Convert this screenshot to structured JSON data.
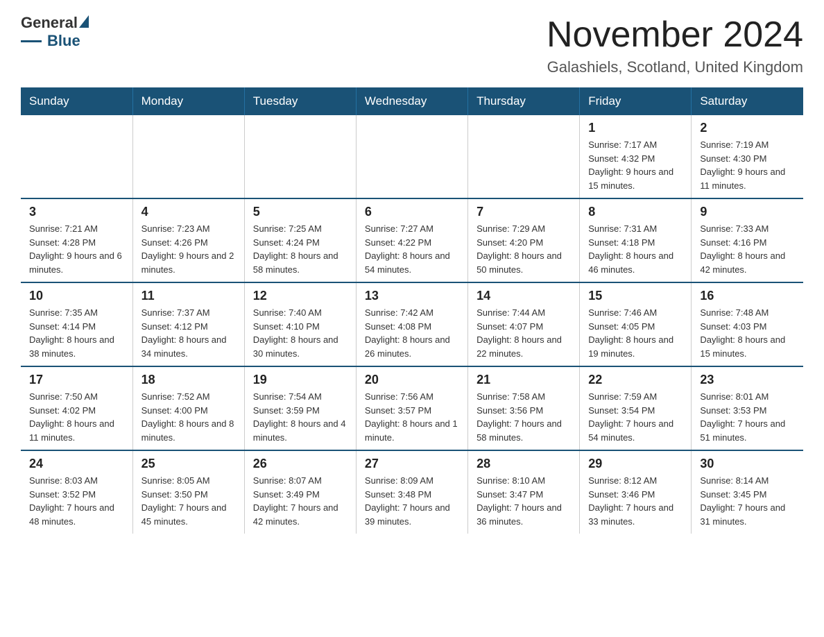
{
  "header": {
    "logo_text": "General",
    "logo_blue": "Blue",
    "month_title": "November 2024",
    "location": "Galashiels, Scotland, United Kingdom"
  },
  "days_of_week": [
    "Sunday",
    "Monday",
    "Tuesday",
    "Wednesday",
    "Thursday",
    "Friday",
    "Saturday"
  ],
  "weeks": [
    [
      {
        "day": "",
        "info": ""
      },
      {
        "day": "",
        "info": ""
      },
      {
        "day": "",
        "info": ""
      },
      {
        "day": "",
        "info": ""
      },
      {
        "day": "",
        "info": ""
      },
      {
        "day": "1",
        "info": "Sunrise: 7:17 AM\nSunset: 4:32 PM\nDaylight: 9 hours and 15 minutes."
      },
      {
        "day": "2",
        "info": "Sunrise: 7:19 AM\nSunset: 4:30 PM\nDaylight: 9 hours and 11 minutes."
      }
    ],
    [
      {
        "day": "3",
        "info": "Sunrise: 7:21 AM\nSunset: 4:28 PM\nDaylight: 9 hours and 6 minutes."
      },
      {
        "day": "4",
        "info": "Sunrise: 7:23 AM\nSunset: 4:26 PM\nDaylight: 9 hours and 2 minutes."
      },
      {
        "day": "5",
        "info": "Sunrise: 7:25 AM\nSunset: 4:24 PM\nDaylight: 8 hours and 58 minutes."
      },
      {
        "day": "6",
        "info": "Sunrise: 7:27 AM\nSunset: 4:22 PM\nDaylight: 8 hours and 54 minutes."
      },
      {
        "day": "7",
        "info": "Sunrise: 7:29 AM\nSunset: 4:20 PM\nDaylight: 8 hours and 50 minutes."
      },
      {
        "day": "8",
        "info": "Sunrise: 7:31 AM\nSunset: 4:18 PM\nDaylight: 8 hours and 46 minutes."
      },
      {
        "day": "9",
        "info": "Sunrise: 7:33 AM\nSunset: 4:16 PM\nDaylight: 8 hours and 42 minutes."
      }
    ],
    [
      {
        "day": "10",
        "info": "Sunrise: 7:35 AM\nSunset: 4:14 PM\nDaylight: 8 hours and 38 minutes."
      },
      {
        "day": "11",
        "info": "Sunrise: 7:37 AM\nSunset: 4:12 PM\nDaylight: 8 hours and 34 minutes."
      },
      {
        "day": "12",
        "info": "Sunrise: 7:40 AM\nSunset: 4:10 PM\nDaylight: 8 hours and 30 minutes."
      },
      {
        "day": "13",
        "info": "Sunrise: 7:42 AM\nSunset: 4:08 PM\nDaylight: 8 hours and 26 minutes."
      },
      {
        "day": "14",
        "info": "Sunrise: 7:44 AM\nSunset: 4:07 PM\nDaylight: 8 hours and 22 minutes."
      },
      {
        "day": "15",
        "info": "Sunrise: 7:46 AM\nSunset: 4:05 PM\nDaylight: 8 hours and 19 minutes."
      },
      {
        "day": "16",
        "info": "Sunrise: 7:48 AM\nSunset: 4:03 PM\nDaylight: 8 hours and 15 minutes."
      }
    ],
    [
      {
        "day": "17",
        "info": "Sunrise: 7:50 AM\nSunset: 4:02 PM\nDaylight: 8 hours and 11 minutes."
      },
      {
        "day": "18",
        "info": "Sunrise: 7:52 AM\nSunset: 4:00 PM\nDaylight: 8 hours and 8 minutes."
      },
      {
        "day": "19",
        "info": "Sunrise: 7:54 AM\nSunset: 3:59 PM\nDaylight: 8 hours and 4 minutes."
      },
      {
        "day": "20",
        "info": "Sunrise: 7:56 AM\nSunset: 3:57 PM\nDaylight: 8 hours and 1 minute."
      },
      {
        "day": "21",
        "info": "Sunrise: 7:58 AM\nSunset: 3:56 PM\nDaylight: 7 hours and 58 minutes."
      },
      {
        "day": "22",
        "info": "Sunrise: 7:59 AM\nSunset: 3:54 PM\nDaylight: 7 hours and 54 minutes."
      },
      {
        "day": "23",
        "info": "Sunrise: 8:01 AM\nSunset: 3:53 PM\nDaylight: 7 hours and 51 minutes."
      }
    ],
    [
      {
        "day": "24",
        "info": "Sunrise: 8:03 AM\nSunset: 3:52 PM\nDaylight: 7 hours and 48 minutes."
      },
      {
        "day": "25",
        "info": "Sunrise: 8:05 AM\nSunset: 3:50 PM\nDaylight: 7 hours and 45 minutes."
      },
      {
        "day": "26",
        "info": "Sunrise: 8:07 AM\nSunset: 3:49 PM\nDaylight: 7 hours and 42 minutes."
      },
      {
        "day": "27",
        "info": "Sunrise: 8:09 AM\nSunset: 3:48 PM\nDaylight: 7 hours and 39 minutes."
      },
      {
        "day": "28",
        "info": "Sunrise: 8:10 AM\nSunset: 3:47 PM\nDaylight: 7 hours and 36 minutes."
      },
      {
        "day": "29",
        "info": "Sunrise: 8:12 AM\nSunset: 3:46 PM\nDaylight: 7 hours and 33 minutes."
      },
      {
        "day": "30",
        "info": "Sunrise: 8:14 AM\nSunset: 3:45 PM\nDaylight: 7 hours and 31 minutes."
      }
    ]
  ]
}
